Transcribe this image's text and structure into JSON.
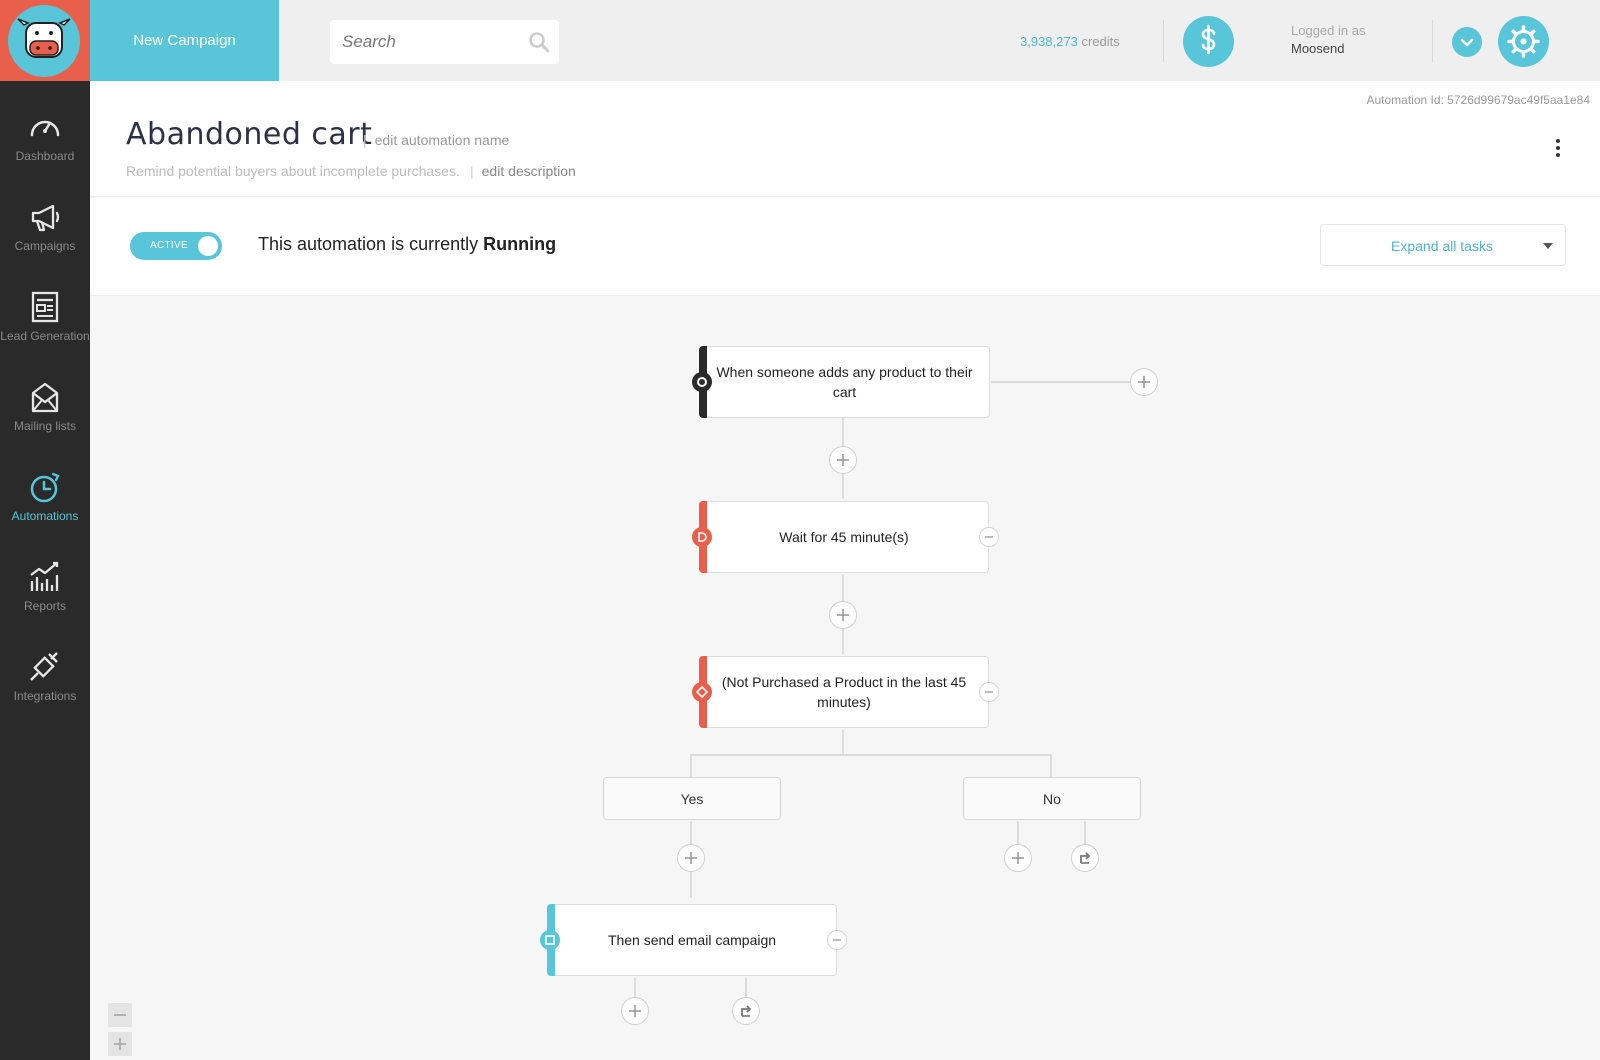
{
  "topbar": {
    "new_campaign": "New Campaign",
    "search_placeholder": "Search",
    "credits_value": "3,938,273",
    "credits_unit": "credits",
    "logged_in_label": "Logged in as",
    "user_name": "Moosend"
  },
  "sidebar": {
    "items": [
      {
        "label": "Dashboard",
        "icon": "gauge-icon",
        "active": false
      },
      {
        "label": "Campaigns",
        "icon": "megaphone-icon",
        "active": false
      },
      {
        "label": "Lead Generation",
        "icon": "form-icon",
        "active": false
      },
      {
        "label": "Mailing lists",
        "icon": "envelope-icon",
        "active": false
      },
      {
        "label": "Automations",
        "icon": "clock-icon",
        "active": true
      },
      {
        "label": "Reports",
        "icon": "chart-icon",
        "active": false
      },
      {
        "label": "Integrations",
        "icon": "plug-icon",
        "active": false
      }
    ]
  },
  "header": {
    "automation_id": "Automation Id: 5726d99679ac49f5aa1e84",
    "title": "Abandoned cart",
    "edit_name": "edit automation name",
    "description": "Remind potential buyers about incomplete purchases.",
    "edit_description": "edit description"
  },
  "status": {
    "toggle_label": "ACTIVE",
    "text_prefix": "This automation is currently",
    "state": "Running",
    "expand_label": "Expand all tasks"
  },
  "workflow": {
    "trigger": "When someone adds any product to their cart",
    "wait": "Wait for 45 minute(s)",
    "condition": "(Not Purchased a Product in the last 45 minutes)",
    "branch_yes": "Yes",
    "branch_no": "No",
    "action": "Then send email campaign"
  },
  "colors": {
    "accent": "#58c6d8",
    "brand_red": "#e8604c",
    "sidebar_bg": "#2a2a2a",
    "trigger_stripe": "#2a2a2a",
    "wait_stripe": "#e8604c",
    "action_stripe": "#58c6d8"
  }
}
